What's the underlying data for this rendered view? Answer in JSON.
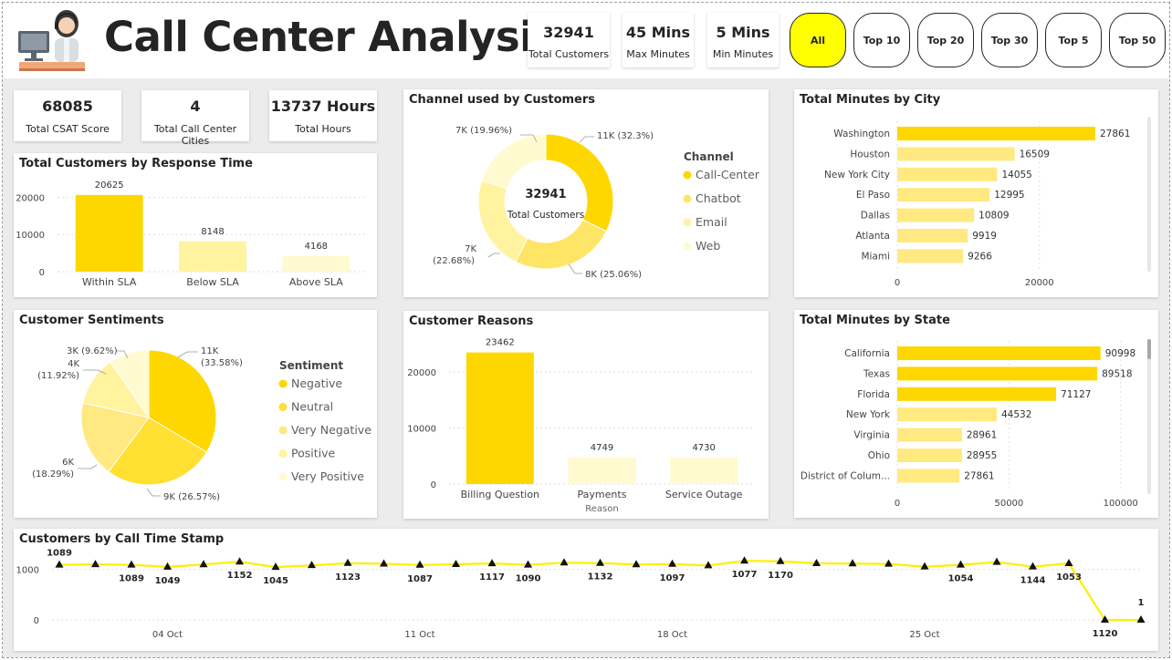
{
  "header": {
    "title": "Call Center Analysis",
    "kpis": [
      {
        "value": "32941",
        "label": "Total Customers"
      },
      {
        "value": "45 Mins",
        "label": "Max Minutes"
      },
      {
        "value": "5 Mins",
        "label": "Min Minutes"
      }
    ],
    "filters": [
      "All",
      "Top 10",
      "Top 20",
      "Top 30",
      "Top 5",
      "Top 50"
    ],
    "active_filter": "All"
  },
  "kpis": [
    {
      "value": "68085",
      "label": "Total CSAT Score"
    },
    {
      "value": "4",
      "label": "Total Call Center Cities"
    },
    {
      "value": "13737 Hours",
      "label": "Total Hours"
    }
  ],
  "colors": {
    "accent": "#ffd700",
    "mid": "#ffe566",
    "light": "#fff3a0",
    "pale": "#fffad0",
    "line": "#ffee00"
  },
  "icons": [
    "call-agent-icon"
  ],
  "chart_data": [
    {
      "id": "response_time",
      "type": "bar",
      "title": "Total Customers by Response Time",
      "categories": [
        "Within SLA",
        "Below SLA",
        "Above SLA"
      ],
      "values": [
        20625,
        8148,
        4168
      ],
      "value_labels": [
        "20625",
        "8148",
        "4168"
      ],
      "yticks": [
        "0",
        "10000",
        "20000"
      ],
      "ylim": [
        0,
        25000
      ],
      "colors": [
        "#ffd700",
        "#fff3a0",
        "#fffad0"
      ]
    },
    {
      "id": "channel",
      "type": "pie",
      "subtype": "donut",
      "title": "Channel used by Customers",
      "center_value": "32941",
      "center_label": "Total Customers",
      "legend_title": "Channel",
      "labels": [
        "Call-Center",
        "Chatbot",
        "Email",
        "Web"
      ],
      "values": [
        32.3,
        25.06,
        22.68,
        19.96
      ],
      "slice_labels": [
        "11K (32.3%)",
        "8K (25.06%)",
        "7K",
        "(22.68%)",
        "7K (19.96%)"
      ],
      "colors": [
        "#ffd700",
        "#ffe566",
        "#fff3a0",
        "#fffad0"
      ]
    },
    {
      "id": "city",
      "type": "bar",
      "orientation": "horizontal",
      "title": "Total Minutes by City",
      "categories": [
        "Washington",
        "Houston",
        "New York City",
        "El Paso",
        "Dallas",
        "Atlanta",
        "Miami"
      ],
      "values": [
        27861,
        16509,
        14055,
        12995,
        10809,
        9919,
        9266
      ],
      "value_labels": [
        "27861",
        "16509",
        "14055",
        "12995",
        "10809",
        "9919",
        "9266"
      ],
      "xticks": [
        "0",
        "20000"
      ],
      "xlim": [
        0,
        33000
      ]
    },
    {
      "id": "sentiment",
      "type": "pie",
      "title": "Customer Sentiments",
      "legend_title": "Sentiment",
      "labels": [
        "Negative",
        "Neutral",
        "Very Negative",
        "Positive",
        "Very Positive"
      ],
      "values": [
        33.58,
        26.57,
        18.29,
        11.92,
        9.62
      ],
      "slice_labels": [
        "11K",
        "(33.58%)",
        "9K (26.57%)",
        "6K",
        "(18.29%)",
        "4K",
        "(11.92%)",
        "3K (9.62%)"
      ],
      "colors": [
        "#ffd700",
        "#ffe033",
        "#ffe980",
        "#fff3a0",
        "#fffad0"
      ]
    },
    {
      "id": "reasons",
      "type": "bar",
      "title": "Customer Reasons",
      "xlabel": "Reason",
      "categories": [
        "Billing Question",
        "Payments",
        "Service Outage"
      ],
      "values": [
        23462,
        4749,
        4730
      ],
      "value_labels": [
        "23462",
        "4749",
        "4730"
      ],
      "yticks": [
        "0",
        "10000",
        "20000"
      ],
      "ylim": [
        0,
        26000
      ],
      "colors": [
        "#ffd700",
        "#fffad0",
        "#fffad0"
      ]
    },
    {
      "id": "state",
      "type": "bar",
      "orientation": "horizontal",
      "title": "Total Minutes by State",
      "categories": [
        "California",
        "Texas",
        "Florida",
        "New York",
        "Virginia",
        "Ohio",
        "District of Colum..."
      ],
      "values": [
        90998,
        89518,
        71127,
        44532,
        28961,
        28955,
        27861
      ],
      "value_labels": [
        "90998",
        "89518",
        "71127",
        "44532",
        "28961",
        "28955",
        "27861"
      ],
      "xticks": [
        "0",
        "50000",
        "100000"
      ],
      "xlim": [
        0,
        105000
      ]
    },
    {
      "id": "timestamp",
      "type": "line",
      "title": "Customers by Call Time Stamp",
      "x": [
        "2020-10-01",
        "2020-10-02",
        "2020-10-03",
        "2020-10-04",
        "2020-10-05",
        "2020-10-06",
        "2020-10-07",
        "2020-10-08",
        "2020-10-09",
        "2020-10-10",
        "2020-10-11",
        "2020-10-12",
        "2020-10-13",
        "2020-10-14",
        "2020-10-15",
        "2020-10-16",
        "2020-10-17",
        "2020-10-18",
        "2020-10-19",
        "2020-10-20",
        "2020-10-21",
        "2020-10-22",
        "2020-10-23",
        "2020-10-24",
        "2020-10-25",
        "2020-10-26",
        "2020-10-27",
        "2020-10-28",
        "2020-10-29",
        "2020-10-30",
        "2020-10-31"
      ],
      "values": [
        1089,
        1100,
        1089,
        1049,
        1098,
        1152,
        1045,
        1080,
        1123,
        1110,
        1087,
        1102,
        1117,
        1090,
        1132,
        1125,
        1097,
        1105,
        1077,
        1170,
        1160,
        1120,
        1115,
        1108,
        1054,
        1090,
        1144,
        1053,
        1120,
        1,
        0
      ],
      "printed_labels": [
        {
          "i": 0,
          "text": "1089",
          "pos": "above"
        },
        {
          "i": 2,
          "text": "1089",
          "pos": "below"
        },
        {
          "i": 3,
          "text": "1049",
          "pos": "below"
        },
        {
          "i": 5,
          "text": "1152",
          "pos": "below"
        },
        {
          "i": 6,
          "text": "1045",
          "pos": "below"
        },
        {
          "i": 8,
          "text": "1123",
          "pos": "below"
        },
        {
          "i": 10,
          "text": "1087",
          "pos": "below"
        },
        {
          "i": 12,
          "text": "1117",
          "pos": "below"
        },
        {
          "i": 13,
          "text": "1090",
          "pos": "below"
        },
        {
          "i": 15,
          "text": "1132",
          "pos": "below"
        },
        {
          "i": 17,
          "text": "1097",
          "pos": "below"
        },
        {
          "i": 19,
          "text": "1077",
          "pos": "below"
        },
        {
          "i": 20,
          "text": "1170",
          "pos": "below"
        },
        {
          "i": 25,
          "text": "1054",
          "pos": "below"
        },
        {
          "i": 27,
          "text": "1144",
          "pos": "below"
        },
        {
          "i": 28,
          "text": "1053",
          "pos": "below"
        },
        {
          "i": 29,
          "text": "1120",
          "pos": "below"
        },
        {
          "i": 30,
          "text": "1",
          "pos": "above"
        }
      ],
      "yticks": [
        "0",
        "1000"
      ],
      "ylim": [
        0,
        1300
      ],
      "xticks": [
        {
          "i": 3,
          "text": "04 Oct"
        },
        {
          "i": 10,
          "text": "11 Oct"
        },
        {
          "i": 17,
          "text": "18 Oct"
        },
        {
          "i": 24,
          "text": "25 Oct"
        }
      ]
    }
  ]
}
